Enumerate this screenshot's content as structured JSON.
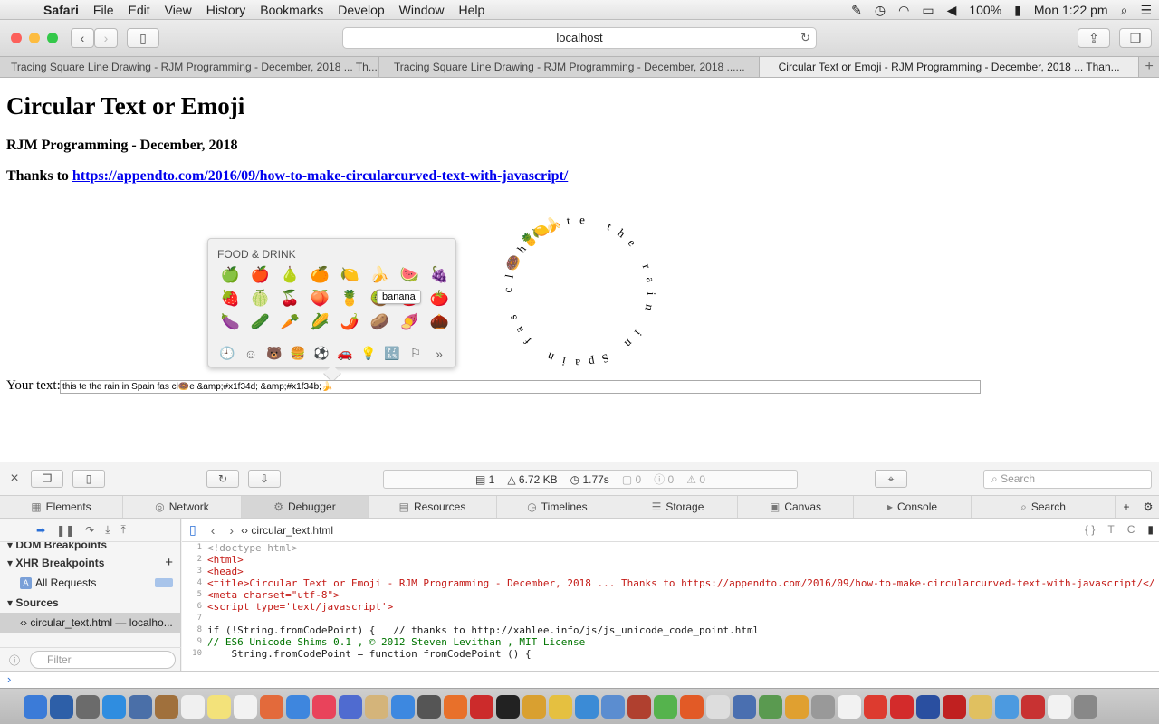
{
  "menubar": {
    "app": "Safari",
    "items": [
      "File",
      "Edit",
      "View",
      "History",
      "Bookmarks",
      "Develop",
      "Window",
      "Help"
    ],
    "battery": "100%",
    "clock": "Mon 1:22 pm"
  },
  "toolbar": {
    "address": "localhost"
  },
  "tabs": [
    "Tracing Square Line Drawing - RJM Programming - December, 2018 ... Th...",
    "Tracing Square Line Drawing - RJM Programming - December, 2018 ......",
    "Circular Text or Emoji - RJM Programming - December, 2018 ... Than..."
  ],
  "page": {
    "title": "Circular Text or Emoji",
    "subtitle": "RJM Programming - December, 2018",
    "thanks_prefix": "Thanks to ",
    "thanks_link": "https://appendto.com/2016/09/how-to-make-circularcurved-text-with-javascript/",
    "input_label": "Your text:",
    "input_value": "this te the rain in Spain fas cl🍩e &amp;#x1f34d; &amp;#x1f34b;🍌"
  },
  "picker": {
    "header": "FOOD & DRINK",
    "tooltip": "banana",
    "emojis": [
      "🍏",
      "🍎",
      "🍐",
      "🍊",
      "🍋",
      "🍌",
      "🍉",
      "🍇",
      "🍓",
      "🍈",
      "🍒",
      "🍑",
      "🍍",
      "🥝",
      "🍅",
      "🍅",
      "🍆",
      "🥒",
      "🥕",
      "🌽",
      "🌶️",
      "🥔",
      "🍠",
      "🌰"
    ],
    "categories": [
      "🕘",
      "☺",
      "🐻",
      "🍔",
      "⚽",
      "🚗",
      "💡",
      "🔣",
      "⚐",
      "»"
    ]
  },
  "circle": {
    "chars": [
      "t",
      "h",
      "i",
      "s",
      " ",
      "t",
      "e",
      " ",
      "t",
      "h",
      "e",
      " ",
      "r",
      "a",
      "i",
      "n",
      " ",
      "i",
      "n",
      " ",
      "S",
      "p",
      "a",
      "i",
      "n",
      " ",
      "f",
      "a",
      "s",
      " ",
      "c",
      "l",
      "🍩",
      " ",
      "🍍",
      "🍋",
      "🍌"
    ]
  },
  "inspector": {
    "resources": "1",
    "size": "6.72 KB",
    "time": "1.77s",
    "messages": "0",
    "warnings": "0",
    "errors": "0",
    "search_placeholder": "Search",
    "tabs": [
      "Elements",
      "Network",
      "Debugger",
      "Resources",
      "Timelines",
      "Storage",
      "Canvas",
      "Console",
      "Search"
    ],
    "sidebar": {
      "dom_breakpoints": "DOM Breakpoints",
      "xhr_breakpoints": "XHR Breakpoints",
      "all_requests": "All Requests",
      "sources": "Sources",
      "source_file": "circular_text.html — localho...",
      "filter_placeholder": "Filter"
    },
    "file": "circular_text.html",
    "code_lines": [
      {
        "n": "1",
        "t": "<!doctype html>",
        "c": "cm"
      },
      {
        "n": "2",
        "t": "<html>",
        "c": ""
      },
      {
        "n": "3",
        "t": "<head>",
        "c": ""
      },
      {
        "n": "4",
        "t": "<title>Circular Text or Emoji - RJM Programming - December, 2018 ... Thanks to https://appendto.com/2016/09/how-to-make-circularcurved-text-with-javascript/</",
        "c": ""
      },
      {
        "n": "5",
        "t": "<meta charset=\"utf-8\">",
        "c": ""
      },
      {
        "n": "6",
        "t": "<script type='text/javascript'>",
        "c": ""
      },
      {
        "n": "7",
        "t": "",
        "c": "js"
      },
      {
        "n": "8",
        "t": "if (!String.fromCodePoint) {   // thanks to http://xahlee.info/js/js_unicode_code_point.html",
        "c": "js"
      },
      {
        "n": "9",
        "t": "// ES6 Unicode Shims 0.1 , © 2012 Steven Levithan , MIT License",
        "c": "green"
      },
      {
        "n": "10",
        "t": "    String.fromCodePoint = function fromCodePoint () {",
        "c": "js"
      }
    ]
  },
  "colors": {
    "close": "#fc605b",
    "minimize": "#fdbc40",
    "zoom": "#34c84a",
    "link": "#0000ee",
    "accent": "#2a6fd6"
  }
}
